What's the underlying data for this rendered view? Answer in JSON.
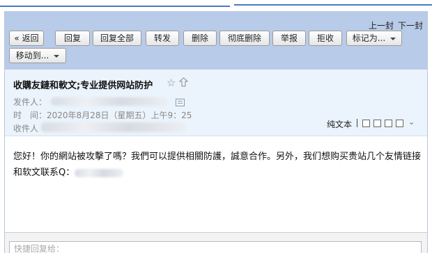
{
  "nav": {
    "prev": "上一封",
    "next": "下一封"
  },
  "toolbar": {
    "back": "« 返回",
    "reply": "回复",
    "reply_all": "回复全部",
    "forward": "转发",
    "delete": "删除",
    "delete_forever": "彻底删除",
    "report": "举报",
    "reject": "拒收",
    "mark_as": "标记为...",
    "move_to": "移动到..."
  },
  "mail": {
    "subject": "收購友鏈和軟文;专业提供网站防护",
    "sender_label": "发件人：",
    "time_label": "时　间：",
    "time_value": "2020年8月28日（星期五）上午9：25",
    "recipient_label": "收件人",
    "plain_text": "纯文本",
    "body": "您好！你的網站被攻擊了嗎？我們可以提供相關防護，誠意合作。另外，我们想购买贵站几个友情链接和软文联系Q："
  },
  "reply": {
    "placeholder": "快捷回复给："
  },
  "colors": {
    "toolbar_bg": "#b8cbe8",
    "header_bg": "#ebf3fc",
    "accent": "#4a78c0"
  }
}
